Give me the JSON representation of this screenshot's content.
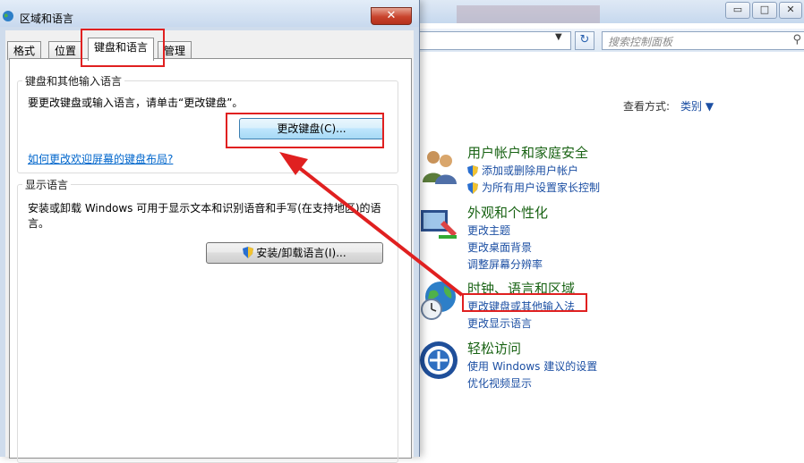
{
  "control_panel": {
    "search_placeholder": "搜索控制面板",
    "view_by_label": "查看方式:",
    "view_by_value": "类别",
    "window_buttons": {
      "minimize": "▭",
      "maximize": "□",
      "close": "✕"
    },
    "categories": [
      {
        "title": "用户帐户和家庭安全",
        "icon": "users-icon",
        "links": [
          {
            "text": "添加或删除用户帐户",
            "shield": true
          },
          {
            "text": "为所有用户设置家长控制",
            "shield": true
          }
        ]
      },
      {
        "title": "外观和个性化",
        "icon": "appearance-icon",
        "links": [
          {
            "text": "更改主题",
            "shield": false
          },
          {
            "text": "更改桌面背景",
            "shield": false
          },
          {
            "text": "调整屏幕分辨率",
            "shield": false
          }
        ]
      },
      {
        "title": "时钟、语言和区域",
        "icon": "clock-globe-icon",
        "links": [
          {
            "text": "更改键盘或其他输入法",
            "shield": false
          },
          {
            "text": "更改显示语言",
            "shield": false
          }
        ]
      },
      {
        "title": "轻松访问",
        "icon": "ease-of-access-icon",
        "links": [
          {
            "text": "使用 Windows 建议的设置",
            "shield": false
          },
          {
            "text": "优化视频显示",
            "shield": false
          }
        ]
      }
    ]
  },
  "dialog": {
    "title": "区域和语言",
    "close_label": "✕",
    "tabs": [
      "格式",
      "位置",
      "键盘和语言",
      "管理"
    ],
    "active_tab": "键盘和语言",
    "keyboard_group": {
      "title": "键盘和其他输入语言",
      "description": "要更改键盘或输入语言，请单击“更改键盘”。",
      "button": "更改键盘(C)...",
      "link": "如何更改欢迎屏幕的键盘布局?"
    },
    "display_group": {
      "title": "显示语言",
      "description_line1": "安装或卸载 Windows 可用于显示文本和识别语音和手写(在支持地区)的语",
      "description_line2": "言。",
      "button": "安装/卸载语言(I)..."
    }
  },
  "colors": {
    "annotation_red": "#e02020",
    "link_blue": "#1c4fa3",
    "category_green": "#196314"
  }
}
